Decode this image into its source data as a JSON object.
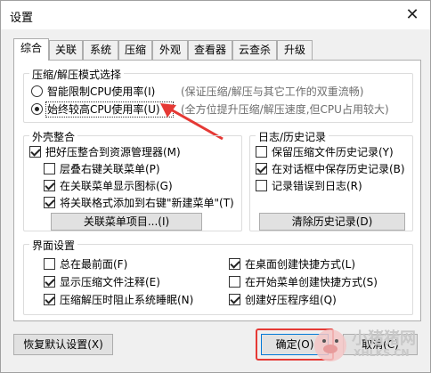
{
  "window": {
    "title": "设置",
    "close_glyph": "✕"
  },
  "tabs": [
    {
      "label": "综合",
      "active": true
    },
    {
      "label": "关联"
    },
    {
      "label": "系统"
    },
    {
      "label": "压缩"
    },
    {
      "label": "外观"
    },
    {
      "label": "查看器"
    },
    {
      "label": "云查杀"
    },
    {
      "label": "升级"
    }
  ],
  "compress_mode": {
    "legend": "压缩/解压模式选择",
    "options": [
      {
        "label": "智能限制CPU使用率(I)",
        "hint": "(保证压缩/解压与其它工作的双重流畅)",
        "checked": false
      },
      {
        "label": "始终较高CPU使用率(U)",
        "hint": "(全方位提升压缩/解压速度,但CPU占用较大)",
        "checked": true
      }
    ]
  },
  "shell": {
    "legend": "外壳整合",
    "items": [
      {
        "label": "把好压整合到资源管理器(M)",
        "checked": true
      },
      {
        "label": "层叠右键关联菜单(P)",
        "checked": false
      },
      {
        "label": "在关联菜单显示图标(G)",
        "checked": true
      },
      {
        "label": "将关联格式添加到右键\"新建菜单\"(T)",
        "checked": true
      }
    ],
    "button": "关联菜单项目...(I)"
  },
  "history": {
    "legend": "日志/历史记录",
    "items": [
      {
        "label": "保留压缩文件历史记录(Y)",
        "checked": false
      },
      {
        "label": "在对话框中保存历史记录(B)",
        "checked": true
      },
      {
        "label": "记录错误到日志(R)",
        "checked": false
      }
    ],
    "button": "清除历史记录(D)"
  },
  "interface": {
    "legend": "界面设置",
    "left": [
      {
        "label": "总在最前面(F)",
        "checked": false
      },
      {
        "label": "显示压缩文件注释(E)",
        "checked": true
      },
      {
        "label": "压缩解压时阻止系统睡眠(N)",
        "checked": true
      }
    ],
    "right": [
      {
        "label": "在桌面创建快捷方式(L)",
        "checked": true
      },
      {
        "label": "在开始菜单创建快捷方式(S)",
        "checked": false
      },
      {
        "label": "创建好压程序组(Q)",
        "checked": true
      }
    ]
  },
  "footer": {
    "restore": "恢复默认设置(X)",
    "ok": "确定(O)",
    "cancel": "取消(C)"
  },
  "watermark": {
    "line1": "小猪猪网",
    "line2": "XHLKS.CN"
  },
  "colors": {
    "annotation_red": "#e53935",
    "accent_blue": "#0078d7"
  }
}
